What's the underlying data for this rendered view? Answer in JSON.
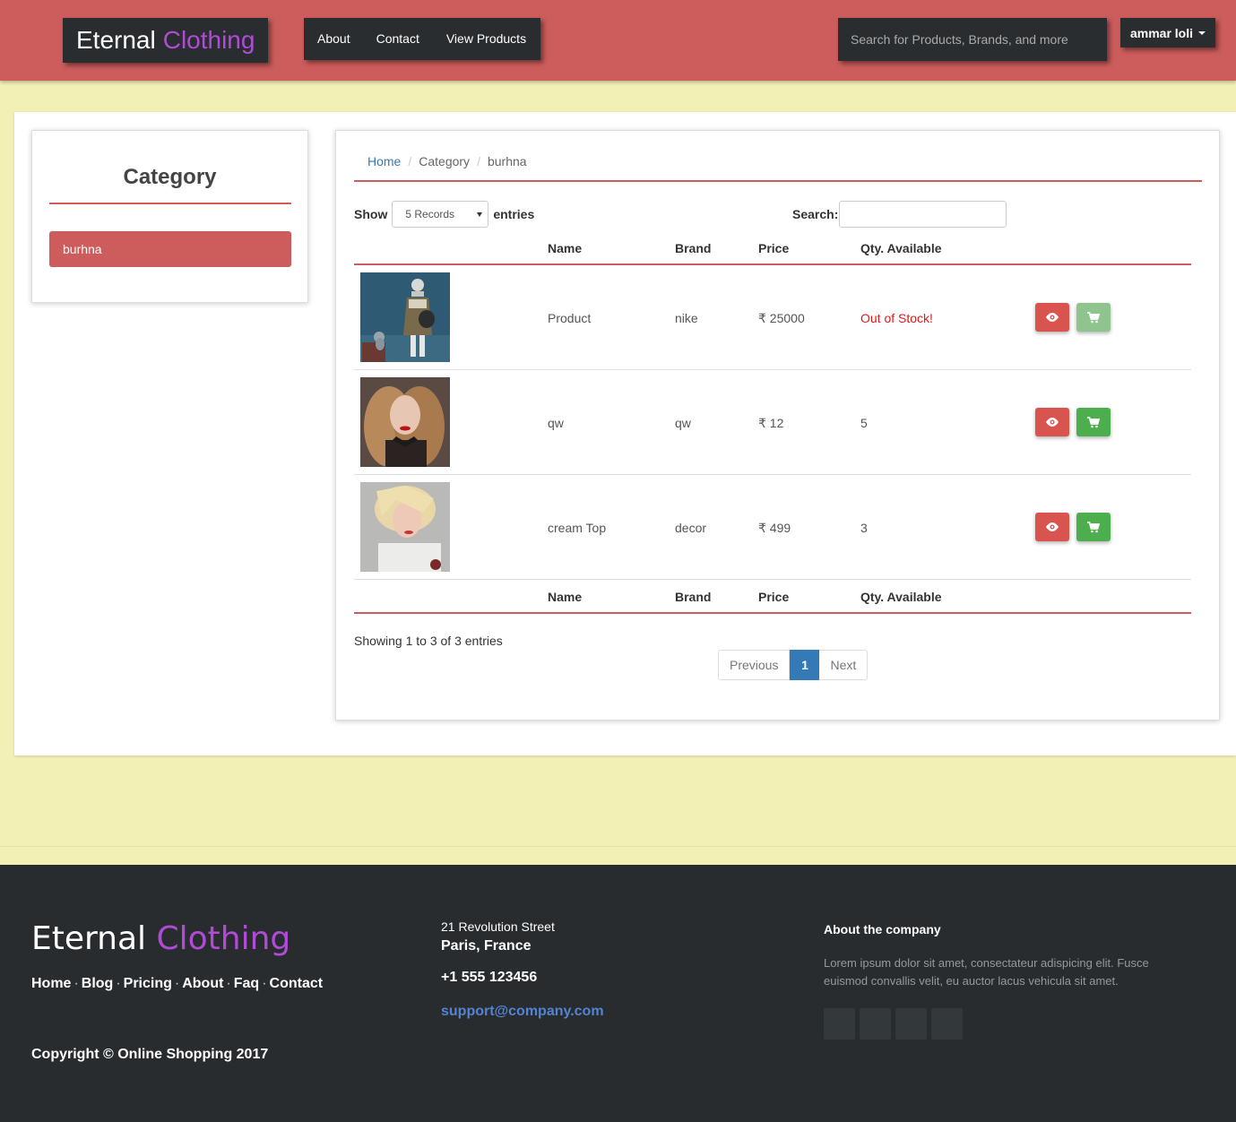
{
  "brand": {
    "name": "Eternal",
    "accent": "Clothing"
  },
  "nav": {
    "about": "About",
    "contact": "Contact",
    "products": "View Products"
  },
  "search_top": {
    "placeholder": "Search for Products, Brands, and more"
  },
  "user": {
    "name": "ammar loli"
  },
  "sidebar": {
    "title": "Category",
    "items": [
      {
        "label": "burhna"
      }
    ]
  },
  "breadcrumb": {
    "home": "Home",
    "category": "Category",
    "current": "burhna"
  },
  "controls": {
    "show": "Show",
    "records": "5 Records",
    "entries": "entries",
    "search_label": "Search:"
  },
  "table": {
    "headers": {
      "name": "Name",
      "brand": "Brand",
      "price": "Price",
      "qty": "Qty. Available"
    },
    "rows": [
      {
        "name": "Product",
        "brand": "nike",
        "price": "₹ 25000",
        "qty": "Out of Stock!"
      },
      {
        "name": "qw",
        "brand": "qw",
        "price": "₹ 12",
        "qty": "5"
      },
      {
        "name": "cream Top",
        "brand": "decor",
        "price": "₹ 499",
        "qty": "3"
      }
    ]
  },
  "info": "Showing 1 to 3 of 3 entries",
  "pager": {
    "prev": "Previous",
    "current": "1",
    "next": "Next"
  },
  "footer": {
    "brand": {
      "name": "Eternal",
      "accent": "Clothing"
    },
    "links": [
      "Home",
      "Blog",
      "Pricing",
      "About",
      "Faq",
      "Contact"
    ],
    "copyright": "Copyright © Online Shopping 2017",
    "address_line1": "21 Revolution Street",
    "address_line2": "Paris, France",
    "phone": "+1 555 123456",
    "email": "support@company.com",
    "about_heading": "About the company",
    "about_text": "Lorem ipsum dolor sit amet, consectateur adispicing elit. Fusce euismod convallis velit, eu auctor lacus vehicula sit amet."
  },
  "colors": {
    "header": "#cd5c5c",
    "dark": "#2a2d30",
    "page_bg": "#f3f0b5",
    "accent_purple": "#b04bd6",
    "primary": "#337ab7",
    "danger": "#d9534f",
    "success": "#4cae4c",
    "out_of_stock": "#e01919"
  },
  "icons": {
    "view": "eye-icon",
    "cart": "cart-icon"
  }
}
